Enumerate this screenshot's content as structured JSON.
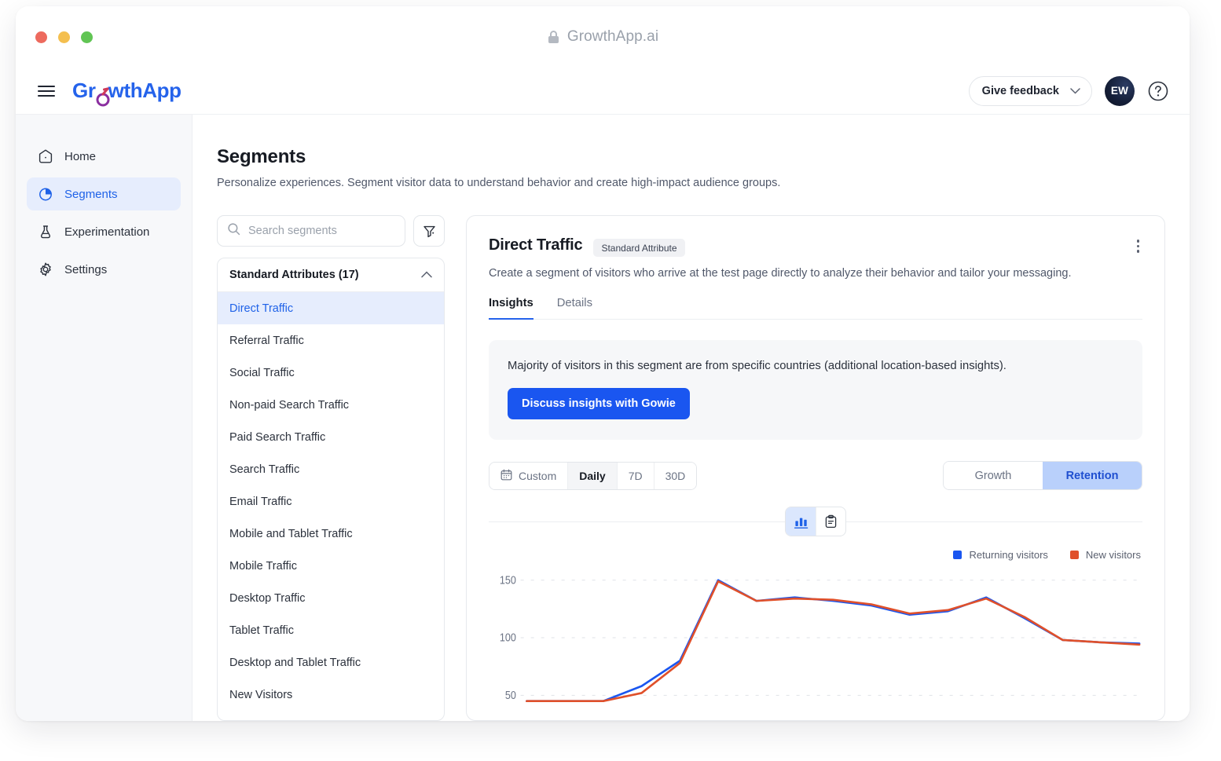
{
  "browser": {
    "url": "GrowthApp.ai",
    "lock_icon": "lock-icon",
    "traffic_lights": [
      "close",
      "minimize",
      "maximize"
    ]
  },
  "appbar": {
    "menu_icon": "hamburger-menu-icon",
    "brand_part1": "Gr",
    "brand_part2": "wthApp",
    "feedback_label": "Give feedback",
    "feedback_chevron": "chevron-down-icon",
    "avatar_initials": "EW",
    "help_icon": "question-mark-circle-icon"
  },
  "sidebar": {
    "items": [
      {
        "label": "Home",
        "icon": "home-icon",
        "active": false
      },
      {
        "label": "Segments",
        "icon": "pie-chart-icon",
        "active": true
      },
      {
        "label": "Experimentation",
        "icon": "flask-icon",
        "active": false
      },
      {
        "label": "Settings",
        "icon": "gear-icon",
        "active": false
      }
    ]
  },
  "page": {
    "title": "Segments",
    "subtitle": "Personalize experiences. Segment visitor data to understand behavior and create high-impact audience groups."
  },
  "search": {
    "placeholder": "Search segments",
    "value": "",
    "icon": "search-icon",
    "filter_icon": "filter-funnel-icon"
  },
  "segment_list": {
    "group_label": "Standard Attributes (17)",
    "group_chevron": "chevron-up-icon",
    "items": [
      {
        "label": "Direct Traffic",
        "selected": true
      },
      {
        "label": "Referral Traffic",
        "selected": false
      },
      {
        "label": "Social Traffic",
        "selected": false
      },
      {
        "label": "Non-paid Search Traffic",
        "selected": false
      },
      {
        "label": "Paid Search Traffic",
        "selected": false
      },
      {
        "label": "Search Traffic",
        "selected": false
      },
      {
        "label": "Email Traffic",
        "selected": false
      },
      {
        "label": "Mobile and Tablet Traffic",
        "selected": false
      },
      {
        "label": "Mobile Traffic",
        "selected": false
      },
      {
        "label": "Desktop Traffic",
        "selected": false
      },
      {
        "label": "Tablet Traffic",
        "selected": false
      },
      {
        "label": "Desktop and Tablet Traffic",
        "selected": false
      },
      {
        "label": "New Visitors",
        "selected": false
      }
    ]
  },
  "detail": {
    "title": "Direct Traffic",
    "badge": "Standard Attribute",
    "kebab_icon": "more-vertical-icon",
    "description": "Create a segment of visitors who arrive at the test page directly to analyze their behavior and tailor your messaging.",
    "tabs": [
      {
        "label": "Insights",
        "active": true
      },
      {
        "label": "Details",
        "active": false
      }
    ],
    "insight_text": "Majority of visitors in this segment are from specific countries (additional location-based insights).",
    "insight_button": "Discuss insights with Gowie"
  },
  "chart_toolbar": {
    "calendar_icon": "calendar-icon",
    "range_buttons": [
      {
        "label": "Custom",
        "active": false
      },
      {
        "label": "Daily",
        "active": true
      },
      {
        "label": "7D",
        "active": false
      },
      {
        "label": "30D",
        "active": false
      }
    ],
    "mode_buttons": [
      {
        "label": "Growth",
        "active": false
      },
      {
        "label": "Retention",
        "active": true
      }
    ],
    "viz_buttons": [
      {
        "icon": "bar-chart-icon",
        "active": true
      },
      {
        "icon": "clipboard-list-icon",
        "active": false
      }
    ]
  },
  "colors": {
    "accent_blue": "#1a56f0",
    "series_returning": "#1a56f0",
    "series_new": "#e0502a",
    "selected_bg": "#e6edfd",
    "retention_bg": "#b9d0fb"
  },
  "chart_data": {
    "type": "line",
    "title": "",
    "xlabel": "",
    "ylabel": "",
    "ylim": [
      30,
      163
    ],
    "yticks": [
      50,
      100,
      150
    ],
    "grid": true,
    "legend_position": "top-right",
    "x": [
      0,
      1,
      2,
      3,
      4,
      5,
      6,
      7,
      8,
      9,
      10,
      11,
      12,
      13,
      14,
      15,
      16
    ],
    "series": [
      {
        "name": "Returning visitors",
        "color": "#1a56f0",
        "values": [
          45,
          45,
          45,
          58,
          80,
          150,
          132,
          135,
          132,
          128,
          120,
          123,
          135,
          117,
          98,
          96,
          95
        ]
      },
      {
        "name": "New visitors",
        "color": "#e0502a",
        "values": [
          45,
          45,
          45,
          52,
          78,
          149,
          132,
          134,
          133,
          129,
          121,
          124,
          134,
          118,
          98,
          96,
          94
        ]
      }
    ]
  }
}
